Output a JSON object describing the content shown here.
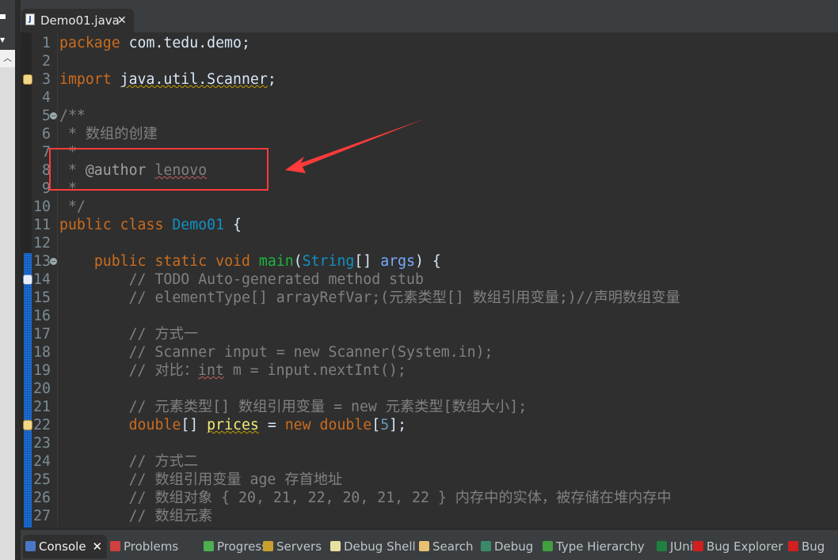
{
  "editor_tab": {
    "title": "Demo01.java",
    "icon": "java-file-warning-icon",
    "close": "✕"
  },
  "lines": [
    [
      [
        "package",
        "kw"
      ],
      [
        " com.tedu.demo;",
        ""
      ]
    ],
    [],
    [
      [
        "import",
        "kw"
      ],
      [
        " ",
        ""
      ],
      [
        "java.util.Scanner",
        "warn"
      ],
      [
        ";",
        ""
      ]
    ],
    [],
    [
      [
        "/**",
        "doc"
      ]
    ],
    [
      [
        " * 数组的创建",
        "doc"
      ]
    ],
    [
      [
        " *",
        "doc"
      ]
    ],
    [
      [
        " * ",
        "doc"
      ],
      [
        "@author",
        "tag"
      ],
      [
        " ",
        "doc"
      ],
      [
        "lenovo",
        "doc spell"
      ]
    ],
    [
      [
        " *",
        "doc"
      ]
    ],
    [
      [
        " */",
        "doc"
      ]
    ],
    [
      [
        "public",
        "kw"
      ],
      [
        " ",
        ""
      ],
      [
        "class",
        "kw"
      ],
      [
        " ",
        ""
      ],
      [
        "Demo01",
        "cls"
      ],
      [
        " {",
        ""
      ]
    ],
    [],
    [
      [
        "    ",
        ""
      ],
      [
        "public",
        "kw"
      ],
      [
        " ",
        ""
      ],
      [
        "static",
        "kw"
      ],
      [
        " ",
        ""
      ],
      [
        "void",
        "kw"
      ],
      [
        " ",
        ""
      ],
      [
        "main",
        "fn"
      ],
      [
        "(",
        ""
      ],
      [
        "String",
        "cls"
      ],
      [
        "[] ",
        ""
      ],
      [
        "args",
        "par"
      ],
      [
        ") {",
        ""
      ]
    ],
    [
      [
        "        // TODO Auto-generated method stub",
        "cm"
      ]
    ],
    [
      [
        "        // elementType[] arrayRefVar;(元素类型[] 数组引用变量;)//声明数组变量",
        "cm"
      ]
    ],
    [],
    [
      [
        "        // 方式一",
        "cm"
      ]
    ],
    [
      [
        "        // Scanner input = new Scanner(System.in);",
        "cm"
      ]
    ],
    [
      [
        "        // 对比：",
        "cm"
      ],
      [
        "int",
        "cm spell"
      ],
      [
        " m = input.nextInt();",
        "cm"
      ]
    ],
    [],
    [
      [
        "        // 元素类型[] 数组引用变量 = new 元素类型[数组大小];",
        "cm"
      ]
    ],
    [
      [
        "        ",
        ""
      ],
      [
        "double",
        "kw"
      ],
      [
        "[] ",
        ""
      ],
      [
        "prices",
        "var warn"
      ],
      [
        " = ",
        ""
      ],
      [
        "new",
        "kw"
      ],
      [
        " ",
        ""
      ],
      [
        "double",
        "kw"
      ],
      [
        "[",
        ""
      ],
      [
        "5",
        "num"
      ],
      [
        "];",
        ""
      ]
    ],
    [],
    [
      [
        "        // 方式二",
        "cm"
      ]
    ],
    [
      [
        "        // 数组引用变量 age 存首地址",
        "cm"
      ]
    ],
    [
      [
        "        // 数组对象 { 20, 21, 22, 20, 21, 22 } 内存中的实体，被存储在堆内存中",
        "cm"
      ]
    ],
    [
      [
        "        // 数组元素",
        "cm"
      ]
    ]
  ],
  "markers": {
    "3": "warning-icon",
    "14": "task-icon",
    "22": "warning-icon"
  },
  "folds": [
    5,
    13
  ],
  "bottom_tabs": [
    {
      "label": "Console",
      "icon": "console-icon",
      "color": "#4a78c8",
      "active": true,
      "close": "✕"
    },
    {
      "label": "Problems",
      "icon": "problems-icon",
      "color": "#d04040"
    },
    {
      "label": "Progress",
      "icon": "progress-icon",
      "color": "#4caf50"
    },
    {
      "label": "Servers",
      "icon": "servers-icon",
      "color": "#c8a030"
    },
    {
      "label": "Debug Shell",
      "icon": "debug-shell-icon",
      "color": "#e8e0a0"
    },
    {
      "label": "Search",
      "icon": "search-icon",
      "color": "#e8c070"
    },
    {
      "label": "Debug",
      "icon": "debug-icon",
      "color": "#3a8a6a"
    },
    {
      "label": "Type Hierarchy",
      "icon": "type-hierarchy-icon",
      "color": "#40a040"
    },
    {
      "label": "JUnit",
      "icon": "junit-icon",
      "color": "#208040"
    },
    {
      "label": "Bug Explorer",
      "icon": "bug-explorer-icon",
      "color": "#d02020"
    },
    {
      "label": "Bug",
      "icon": "bug-icon",
      "color": "#d02020"
    }
  ],
  "annotation_color": "#ff3b3b"
}
